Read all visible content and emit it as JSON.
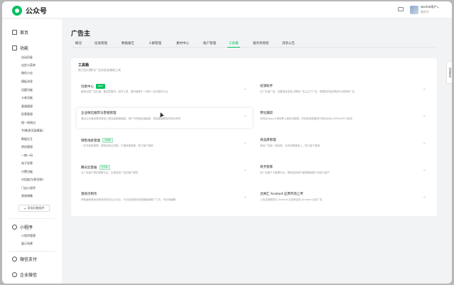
{
  "app": {
    "name": "公众号"
  },
  "account": {
    "name": "wechat用户",
    "sub": "服务号"
  },
  "sidebar": {
    "home": "首页",
    "functions": "功能",
    "items": [
      "自动回复",
      "自定义菜单",
      "微信小店",
      "模板消息",
      "话题功能",
      "卡券功能",
      "客服管理",
      "投票管理",
      "摇一摇周边",
      "专辑(原页面模板)",
      "数据交互",
      "原创管理",
      "一物一码",
      "电子发票",
      "付费功能",
      "对话能力(原导购)",
      "门店小程序",
      "视频弹幕"
    ],
    "add_plugin": "添加功能插件",
    "mini_program": "小程序",
    "mini_items": [
      "小程序管理",
      "展示场景"
    ],
    "wechat_pay": "微信支付",
    "work_wechat": "企业微信"
  },
  "main": {
    "title": "广告主",
    "tabs": [
      "概况",
      "投放管理",
      "数据报告",
      "人群管理",
      "素材中心",
      "账户管理",
      "工具箱",
      "服务商授权",
      "消息公告"
    ],
    "card_title": "工具箱",
    "card_sub": "助力您对腾讯广告的各类辅助工具",
    "tools": [
      {
        "name": "创意中心",
        "badge": "NEW",
        "badge_type": "new",
        "desc": "聚焦创意广告拉通，集创意素材、制作工具、素材管理于一体的一站式服务平台"
      },
      {
        "name": "投放助手",
        "badge": "",
        "badge_type": "",
        "desc": "在广告推广前，设置投放信息以帮助广告主生产广告，根据您的投放需求为您推荐广告"
      },
      {
        "name": "企业微信推荐与客服管理",
        "badge": "",
        "badge_type": "",
        "desc": "通过企业微信提供商家工具连接客服链路，用户可快速连接客服，提高客服服务的转化效率"
      },
      {
        "name": "转化跟踪",
        "badge": "",
        "badge_type": "",
        "desc": "在网页/App/小程序等上报转化数据，同时使用数据进行转化优化(oCPM/oCPC)投放"
      },
      {
        "name": "销售线索管理",
        "badge": "已授权",
        "badge_type": "ok",
        "desc": "一站式线索管理，获取线索全流程，打通线索链路，助力客户营销"
      },
      {
        "name": "商品库管理",
        "badge": "",
        "badge_type": "",
        "desc": "商品广告统一商品库，支持多渠道接入，助力客户营销"
      },
      {
        "name": "腾讯云客服",
        "badge": "已开通",
        "badge_type": "ok",
        "desc": "为广告客户提供客服平台，实现投放广告的客户服务"
      },
      {
        "name": "商务管家",
        "badge": "",
        "badge_type": "",
        "desc": "将广告客户与管理平台，帮助投放商户管理营销账户信息与客户"
      },
      {
        "name": "落地页制作",
        "badge": "",
        "badge_type": "",
        "desc": "获取营销落地页服务的相关企业平台，可为投放落地页配置营销推广人员，可在线编辑"
      },
      {
        "name": "灵犀汇 Android 应用市场上传",
        "badge": "",
        "badge_type": "",
        "desc": "上传并管理您在 Android 应用商店的 Android 应用广告"
      }
    ]
  },
  "float_panel": {
    "label": "快速帮助"
  },
  "colors": {
    "accent": "#07c160",
    "background": "#f2f3f5"
  }
}
